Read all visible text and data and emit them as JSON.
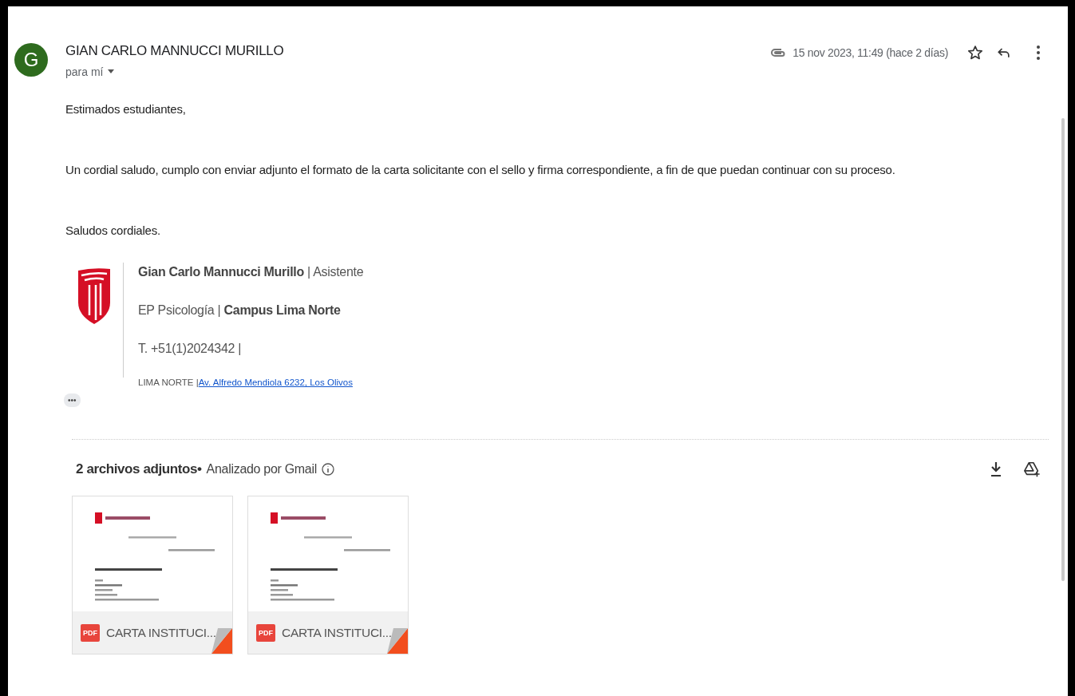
{
  "sender": {
    "avatar_letter": "G",
    "name": "GIAN CARLO MANNUCCI MURILLO",
    "recipient": "para mí"
  },
  "date": "15 nov 2023, 11:49 (hace 2 días)",
  "starred": false,
  "body": [
    "Estimados estudiantes,",
    "Un cordial saludo, cumplo con enviar adjunto el formato de la carta solicitante con el sello y firma correspondiente, a fin de que puedan continuar con su proceso.",
    "Saludos cordiales."
  ],
  "signature": {
    "lines": [
      "**Gian Carlo Mannucci Murillo** | Asistente",
      "EP Psicología | **Campus Lima Norte**",
      "T. +51(1)2024342 |"
    ],
    "address_label": "LIMA NORTE |",
    "address_link": "Av. Alfredo Mendiola 6232,  Los Olivos"
  },
  "more_button": "•••",
  "attachments": {
    "title": "2 archivos adjuntos•",
    "scan_note": "Analizado por Gmail",
    "files": [
      {
        "badge": "PDF",
        "name": "CARTA INSTITUCI..."
      },
      {
        "badge": "PDF",
        "name": "CARTA INSTITUCI..."
      }
    ]
  }
}
